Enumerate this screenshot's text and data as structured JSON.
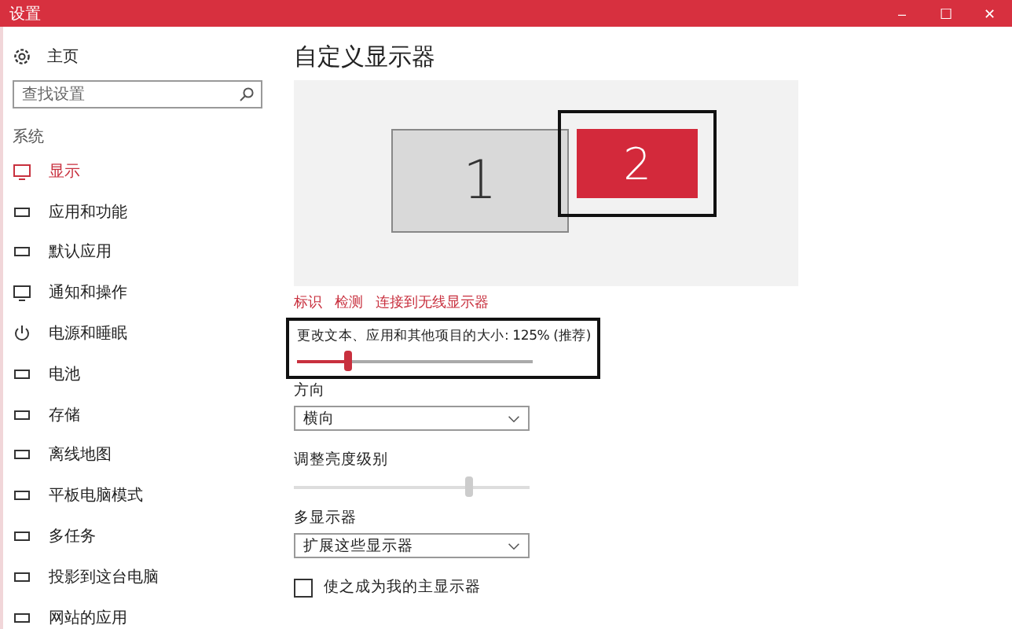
{
  "window": {
    "title": "设置",
    "controls": [
      "–",
      "☐",
      "✕"
    ]
  },
  "sidebar": {
    "home": "主页",
    "search": {
      "placeholder": "查找设置"
    },
    "section": "系统",
    "items": [
      {
        "label": "显示",
        "selected": true
      },
      {
        "label": "应用和功能",
        "selected": false
      },
      {
        "label": "默认应用",
        "selected": false
      },
      {
        "label": "通知和操作",
        "selected": false
      },
      {
        "label": "电源和睡眠",
        "selected": false
      },
      {
        "label": "电池",
        "selected": false
      },
      {
        "label": "存储",
        "selected": false
      },
      {
        "label": "离线地图",
        "selected": false
      },
      {
        "label": "平板电脑模式",
        "selected": false
      },
      {
        "label": "多任务",
        "selected": false
      },
      {
        "label": "投影到这台电脑",
        "selected": false
      },
      {
        "label": "网站的应用",
        "selected": false
      }
    ]
  },
  "main": {
    "heading": "自定义显示器",
    "displays": [
      {
        "number": "1",
        "selected": false
      },
      {
        "number": "2",
        "selected": true
      }
    ],
    "links": [
      "标识",
      "检测",
      "连接到无线显示器"
    ],
    "scale": {
      "label": "更改文本、应用和其他项目的大小: 125% (推荐)",
      "level": 0.21,
      "highlighted": true
    },
    "orientation": {
      "label": "方向",
      "value": "横向"
    },
    "brightness": {
      "label": "调整亮度级别",
      "level": 0.74,
      "disabled": true
    },
    "multiple": {
      "label": "多显示器",
      "value": "扩展这些显示器"
    },
    "primary": {
      "label": "使之成为我的主显示器",
      "checked": false
    }
  }
}
